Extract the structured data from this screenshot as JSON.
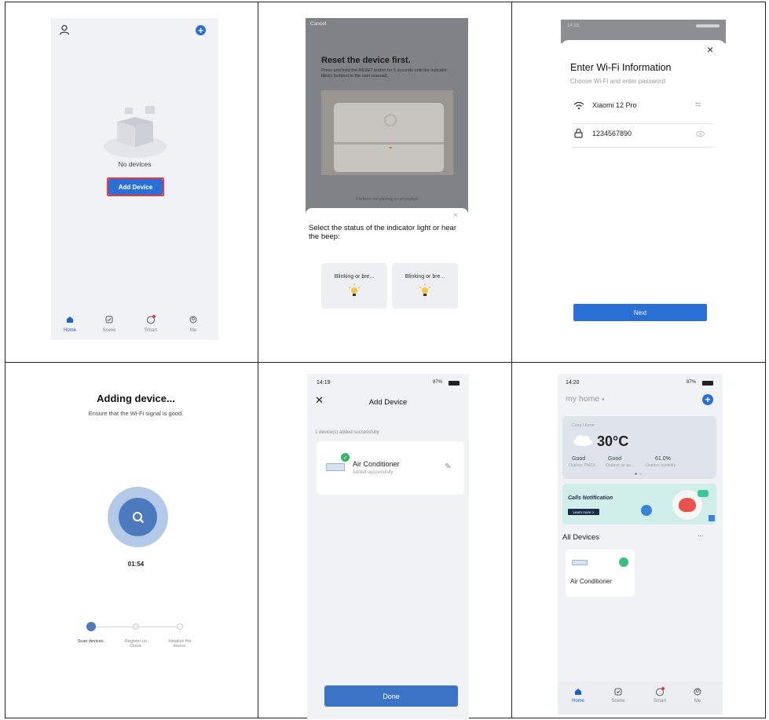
{
  "s1": {
    "empty_text": "No devices",
    "add_button": "Add Device",
    "nav": [
      "Home",
      "Scene",
      "Smart",
      "Me"
    ],
    "accent": "#2a6fd6"
  },
  "s2": {
    "cancel": "Cancel",
    "title": "Reset the device first.",
    "instructions": "Press and hold the RESET button for 5 seconds until the indicator blinks (subject to the user manual).",
    "pairing_hint": "Perform net pairing as prompted",
    "sheet_title": "Select the status of the indicator light or hear the beep:",
    "option_1": "Blinking or bre...",
    "option_2": "Blinking or bre..."
  },
  "s3": {
    "status_time": "14:18",
    "title": "Enter Wi-Fi Information",
    "subtitle": "Choose Wi-Fi and enter password",
    "ssid": "Xiaomi 12 Pro",
    "password": "1234567890",
    "next": "Next"
  },
  "s4": {
    "title": "Adding device...",
    "subtitle": "Ensure that the Wi-Fi signal is good.",
    "timer": "01:54",
    "steps": [
      "Scan devices.",
      "Register on Cloud.",
      "Initialize the device."
    ]
  },
  "s5": {
    "status_time": "14:19",
    "status_right": "87%",
    "title": "Add Device",
    "success_count": "1 device(s) added successfully",
    "device_name": "Air Conditioner",
    "device_status": "Added successfully",
    "done": "Done"
  },
  "s6": {
    "status_time": "14:20",
    "status_right": "87%",
    "home_name": "my home",
    "weather_label": "Cozy Home",
    "temperature": "30°C",
    "pm25_value": "Good",
    "pm25_label": "Outdoor PM2.5",
    "air_value": "Good",
    "air_label": "Outdoor air qu...",
    "humidity_value": "61.0%",
    "humidity_label": "Outdoor humidity",
    "banner_title": "Calls Notification",
    "banner_button": "Learn more >",
    "section_title": "All Devices",
    "more": "...",
    "device_name": "Air Conditioner",
    "nav": [
      "Home",
      "Scene",
      "Smart",
      "Me"
    ]
  }
}
